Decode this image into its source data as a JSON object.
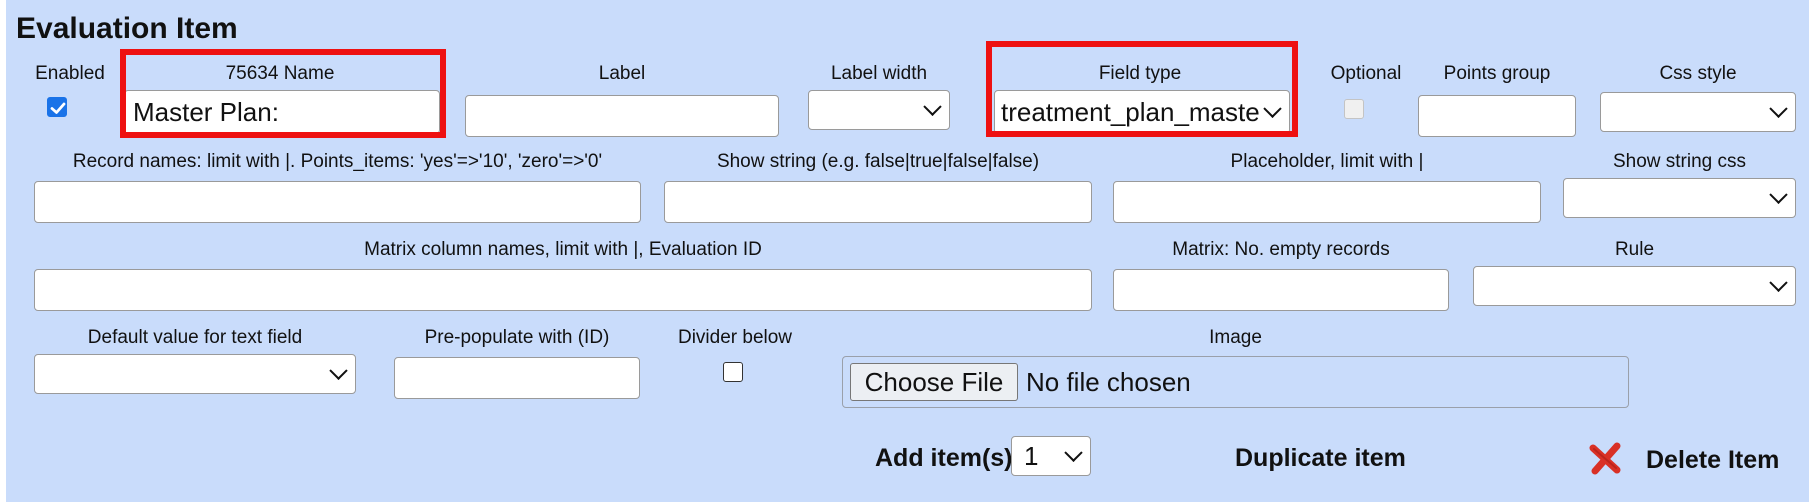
{
  "section_title": "Evaluation Item",
  "row1": {
    "enabled_label": "Enabled",
    "enabled_checked": true,
    "name_label": "75634 Name",
    "name_value": "Master Plan:",
    "label_label": "Label",
    "label_value": "",
    "label_width_label": "Label width",
    "label_width_value": "",
    "field_type_label": "Field type",
    "field_type_value": "treatment_plan_maste",
    "optional_label": "Optional",
    "optional_checked": false,
    "points_group_label": "Points group",
    "points_group_value": "",
    "css_style_label": "Css style",
    "css_style_value": ""
  },
  "row2": {
    "record_names_label": "Record names: limit with |. Points_items: 'yes'=>'10', 'zero'=>'0'",
    "show_string_label": "Show string (e.g. false|true|false|false)",
    "placeholder_label": "Placeholder, limit with |",
    "show_string_css_label": "Show string css"
  },
  "row3": {
    "matrix_columns_label": "Matrix column names, limit with |, Evaluation ID",
    "matrix_empty_label": "Matrix: No. empty records",
    "rule_label": "Rule"
  },
  "row4": {
    "default_value_label": "Default value for text field",
    "prepopulate_label": "Pre-populate with (ID)",
    "divider_label": "Divider below",
    "divider_checked": false,
    "image_label": "Image",
    "choose_file_label": "Choose File",
    "no_file_text": "No file chosen"
  },
  "actions": {
    "add_items_label": "Add item(s)",
    "add_items_value": "1",
    "duplicate_label": "Duplicate item",
    "delete_label": "Delete Item"
  },
  "colors": {
    "panel_bg": "#c9dcfb",
    "highlight": "#ee1111",
    "checkbox_blue": "#1a73e8",
    "delete_red": "#d93025"
  }
}
